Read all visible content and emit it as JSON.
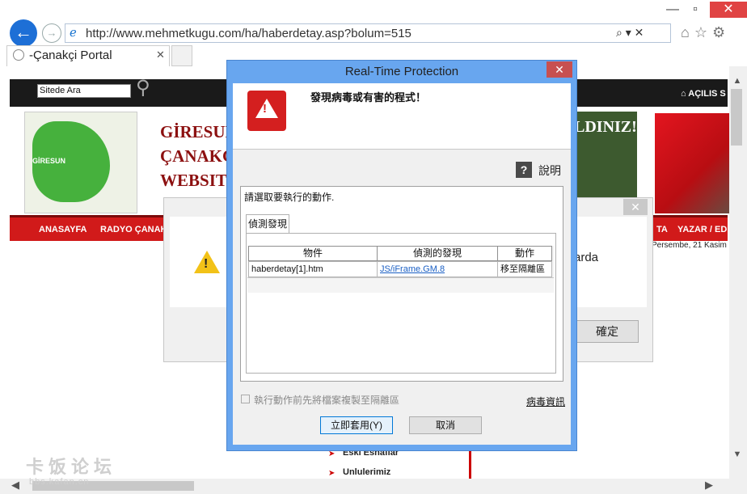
{
  "browser": {
    "url": "http://www.mehmetkugu.com/ha/haberdetay.asp?bolum=515",
    "tab_title": "-Çanakçi Portal",
    "window_minimize": "—",
    "window_close": "✕",
    "address_controls": "⌕ ▾ ✕",
    "tool_icons": "⌂☆⚙"
  },
  "webpage": {
    "search_box_text": "Sitede Ara",
    "home_link": "⌂ AÇILIS S",
    "site_title": "GİRESUN ÇANAKÇI WEBSITE",
    "map_label": "GİRESUN",
    "banner_text": "LDINIZ!",
    "menu": [
      "ANASAYFA",
      "RADYO ÇANAK",
      "TA",
      "YAZAR / EDİ"
    ],
    "date": "Persembe, 21 Kasim",
    "side_items": [
      "Eski Esnaflar",
      "Unlulerimiz"
    ]
  },
  "background_dialog": {
    "partial_text": "arda",
    "ok_button": "確定",
    "close": "✕"
  },
  "rtp_dialog": {
    "title": "Real-Time Protection",
    "close": "✕",
    "heading": "發現病毒或有害的程式！",
    "help_label": "說明",
    "instruction": "請選取要執行的動作.",
    "tab": "偵測發現",
    "columns": [
      "物件",
      "偵測的發現",
      "動作"
    ],
    "rows": [
      {
        "object": "haberdetay[1].htm",
        "detection": "JS/iFrame.GM.8",
        "action": "移至隔離區"
      }
    ],
    "checkbox_label": "執行動作前先將檔案複製至隔離區",
    "virus_info_link": "病毒資訊",
    "apply_button": "立即套用(Y)",
    "cancel_button": "取消"
  },
  "watermark": {
    "line1": "卡饭论坛",
    "line2": "bbs.kafan.cn"
  },
  "colors": {
    "dialog_border": "#68a6ef",
    "alert_red": "#d41f1f",
    "menu_red": "#d11a1a",
    "ie_blue": "#1d6fd6"
  }
}
